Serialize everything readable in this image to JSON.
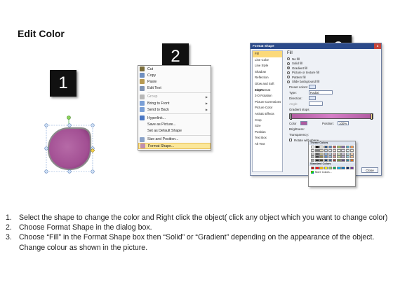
{
  "title": "Edit Color",
  "badges": [
    "1",
    "2",
    "3"
  ],
  "context_menu": {
    "items": [
      {
        "label": "Cut",
        "icon": "scissors-icon",
        "color": "#7a6d3a"
      },
      {
        "label": "Copy",
        "icon": "copy-icon",
        "color": "#6f8fc0"
      },
      {
        "label": "Paste",
        "icon": "paste-icon",
        "color": "#b89a52"
      },
      {
        "label": "Edit Text",
        "icon": "edit-text-icon",
        "color": "#7f93b3"
      },
      {
        "label": "Group",
        "icon": "group-icon",
        "color": "#b7b7b7",
        "disabled": true,
        "submenu": true
      },
      {
        "label": "Bring to Front",
        "icon": "bring-front-icon",
        "color": "#7a9fd6",
        "submenu": true
      },
      {
        "label": "Send to Back",
        "icon": "send-back-icon",
        "color": "#7a9fd6",
        "submenu": true
      },
      {
        "label": "Hyperlink...",
        "icon": "hyperlink-icon",
        "color": "#4a77c4"
      },
      {
        "label": "Save as Picture...",
        "icon": "",
        "color": ""
      },
      {
        "label": "Set as Default Shape",
        "icon": "",
        "color": ""
      },
      {
        "label": "Size and Position...",
        "icon": "size-position-icon",
        "color": "#8aa2c8"
      },
      {
        "label": "Format Shape...",
        "icon": "format-shape-icon",
        "color": "#c08fb0",
        "highlighted": true
      }
    ]
  },
  "format_dialog": {
    "title": "Format Shape",
    "close_x": "x",
    "categories": [
      "Fill",
      "Line Color",
      "Line Style",
      "Shadow",
      "Reflection",
      "Glow and Soft Edges",
      "3-D Format",
      "3-D Rotation",
      "Picture Corrections",
      "Picture Color",
      "Artistic Effects",
      "Crop",
      "Size",
      "Position",
      "Text Box",
      "Alt Text"
    ],
    "selected_category": "Fill",
    "heading": "Fill",
    "fill_options": [
      {
        "label": "No fill",
        "on": false
      },
      {
        "label": "Solid fill",
        "on": false
      },
      {
        "label": "Gradient fill",
        "on": true
      },
      {
        "label": "Picture or texture fill",
        "on": false
      },
      {
        "label": "Pattern fill",
        "on": false
      },
      {
        "label": "Slide background fill",
        "on": false
      }
    ],
    "preset_colors_label": "Preset colors:",
    "type_label": "Type:",
    "type_value": "Radial",
    "direction_label": "Direction:",
    "angle_label": "Angle:",
    "gradient_stops_label": "Gradient stops",
    "color_label": "Color",
    "position_label": "Position:",
    "position_value": "100%",
    "brightness_label": "Brightness:",
    "transparency_label": "Transparency:",
    "rotate_label": "Rotate with shape",
    "close_label": "Close"
  },
  "palette": {
    "theme_header": "Theme Colors",
    "standard_header": "Standard Colors",
    "more_label": "More Colors...",
    "theme_colors": [
      "#ffffff",
      "#000000",
      "#eeece1",
      "#1f497d",
      "#4f81bd",
      "#c0504d",
      "#9bbb59",
      "#8064a2",
      "#4bacc6",
      "#f79646",
      "#f2f2f2",
      "#7f7f7f",
      "#ddd9c3",
      "#c6d9f0",
      "#dbe5f1",
      "#f2dcdb",
      "#ebf1dd",
      "#e5e0ec",
      "#dbeef3",
      "#fdeada",
      "#d8d8d8",
      "#595959",
      "#c4bd97",
      "#8db3e2",
      "#b8cce4",
      "#e5b9b7",
      "#d7e3bc",
      "#ccc1d9",
      "#b7dde8",
      "#fbd5b5",
      "#bfbfbf",
      "#3f3f3f",
      "#938953",
      "#548dd4",
      "#95b3d7",
      "#d99694",
      "#c3d69b",
      "#b2a2c7",
      "#92cddc",
      "#fac08f",
      "#a5a5a5",
      "#262626",
      "#494429",
      "#17365d",
      "#366092",
      "#953734",
      "#76923c",
      "#5f497a",
      "#31859b",
      "#e36c09"
    ],
    "standard_colors": [
      "#c00000",
      "#ff0000",
      "#ffc000",
      "#ffff00",
      "#92d050",
      "#00b050",
      "#00b0f0",
      "#0070c0",
      "#002060",
      "#7030a0"
    ]
  },
  "instructions": [
    {
      "num": "1.",
      "text": "Select the shape to change the color and Right click the object( click any object which you want to change color)"
    },
    {
      "num": "2.",
      "text": "Choose Format Shape in the dialog box."
    },
    {
      "num": "3.",
      "text": "Choose “Fill” in the Format Shape box then “Solid” or “Gradient” depending on the appearance of the object. Change colour as shown in the picture."
    }
  ],
  "colors": {
    "badge_bg": "#111111",
    "shape_fill": "#b05aa0",
    "shape_border": "#7f7f7f",
    "menu_highlight": "#fbe79a",
    "dialog_title_bg": "#2b4a8a"
  }
}
